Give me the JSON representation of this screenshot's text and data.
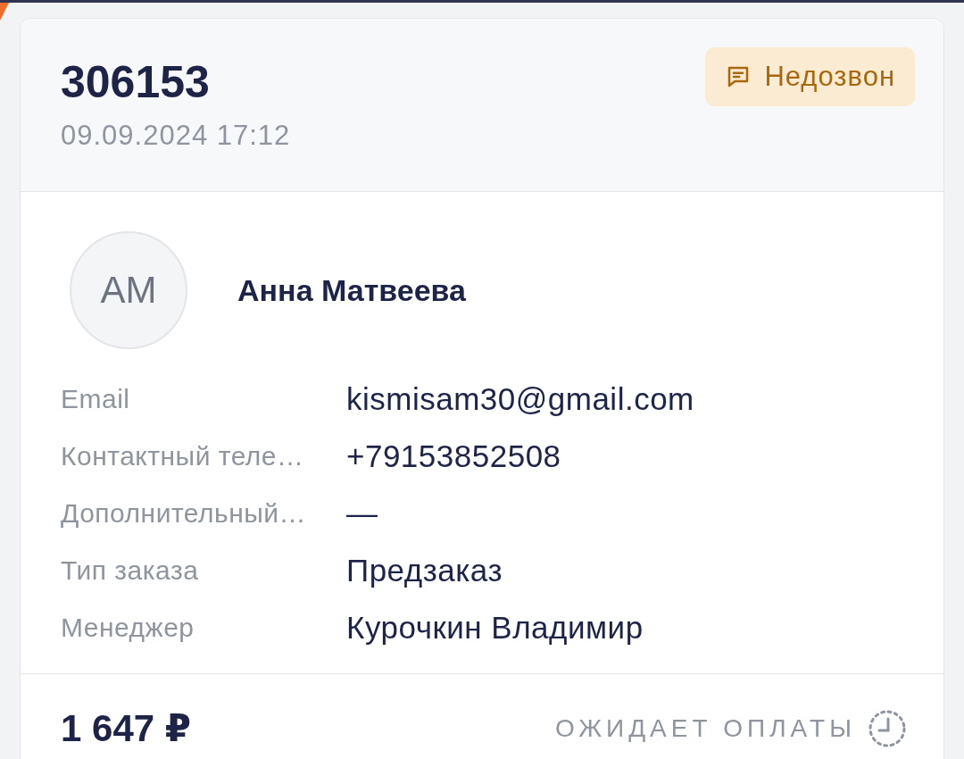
{
  "order": {
    "number": "306153",
    "date": "09.09.2024 17:12",
    "status": {
      "label": "Недозвон",
      "kind": "warning"
    }
  },
  "customer": {
    "initials": "АМ",
    "name": "Анна Матвеева"
  },
  "fields": [
    {
      "label": "Email",
      "value": "kismisam30@gmail.com"
    },
    {
      "label": "Контактный теле…",
      "value": "+79153852508"
    },
    {
      "label": "Дополнительный…",
      "value": "—"
    },
    {
      "label": "Тип заказа",
      "value": "Предзаказ"
    },
    {
      "label": "Менеджер",
      "value": "Курочкин Владимир"
    }
  ],
  "footer": {
    "total": "1 647 ₽",
    "payment_status": {
      "label": "ОЖИДАЕТ ОПЛАТЫ",
      "kind": "pending"
    }
  }
}
